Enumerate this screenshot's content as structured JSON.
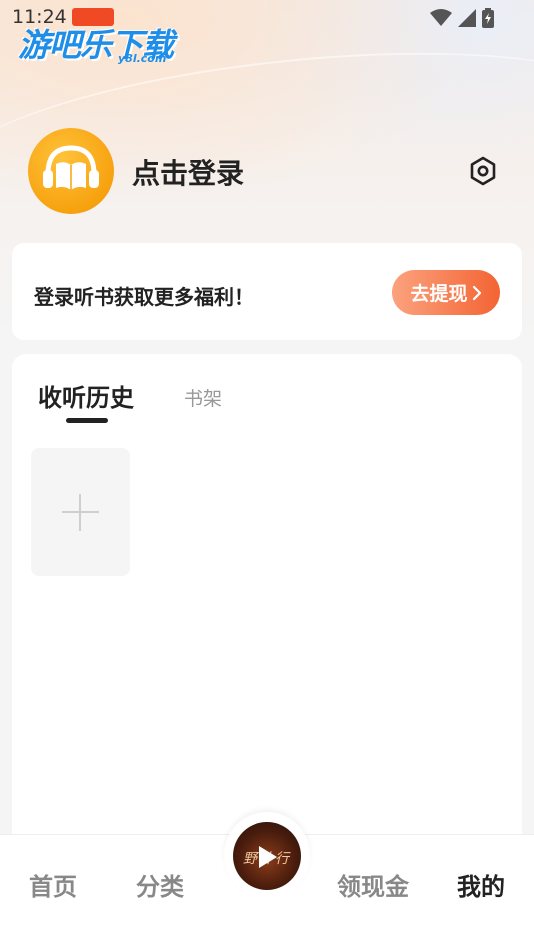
{
  "status_bar": {
    "time": "11:24"
  },
  "watermark": {
    "name": "游吧乐下载",
    "domain": "y8l.com"
  },
  "profile": {
    "login_label": "点击登录",
    "avatar_icon": "book-headphones-icon",
    "settings_icon": "hexagon-gear-icon"
  },
  "promo": {
    "text": "登录听书获取更多福利！",
    "button_label": "去提现"
  },
  "library": {
    "tabs": [
      {
        "label": "收听历史",
        "active": true
      },
      {
        "label": "书架",
        "active": false
      }
    ],
    "add_icon": "plus-icon"
  },
  "player": {
    "cover_text": "野外行",
    "play_icon": "play-icon"
  },
  "tabbar": {
    "items": [
      {
        "label": "首页",
        "active": false
      },
      {
        "label": "分类",
        "active": false
      },
      {
        "label": "领现金",
        "active": false
      },
      {
        "label": "我的",
        "active": true
      }
    ]
  },
  "colors": {
    "accent_orange": "#f36433",
    "avatar_yellow": "#f7a20f",
    "watermark_blue": "#1f8ee8"
  }
}
